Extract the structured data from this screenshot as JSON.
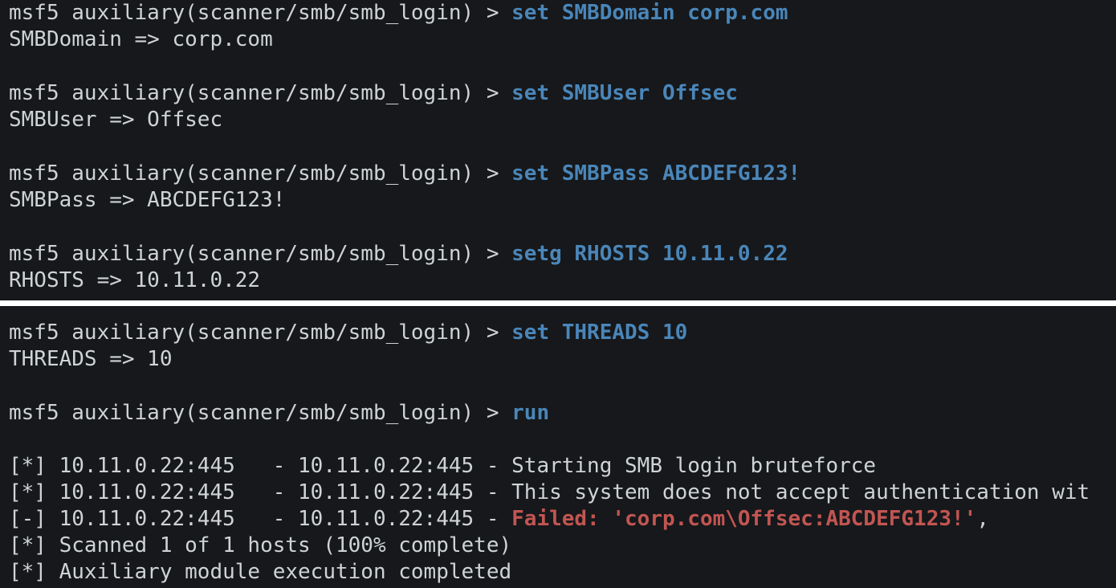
{
  "top": {
    "block1": {
      "prompt": "msf5 auxiliary(scanner/smb/smb_login) > ",
      "command": "set SMBDomain corp.com",
      "output": "SMBDomain => corp.com"
    },
    "block2": {
      "prompt": "msf5 auxiliary(scanner/smb/smb_login) > ",
      "command": "set SMBUser Offsec",
      "output": "SMBUser => Offsec"
    },
    "block3": {
      "prompt": "msf5 auxiliary(scanner/smb/smb_login) > ",
      "command": "set SMBPass ABCDEFG123!",
      "output": "SMBPass => ABCDEFG123!"
    },
    "block4": {
      "prompt": "msf5 auxiliary(scanner/smb/smb_login) > ",
      "command": "setg RHOSTS 10.11.0.22",
      "output": "RHOSTS => 10.11.0.22"
    }
  },
  "bottom": {
    "block1": {
      "prompt": "msf5 auxiliary(scanner/smb/smb_login) > ",
      "command": "set THREADS 10",
      "output": "THREADS => 10"
    },
    "block2": {
      "prompt": "msf5 auxiliary(scanner/smb/smb_login) > ",
      "command": "run"
    },
    "results": {
      "line1": "[*] 10.11.0.22:445   - 10.11.0.22:445 - Starting SMB login bruteforce",
      "line2": "[*] 10.11.0.22:445   - 10.11.0.22:445 - This system does not accept authentication wit",
      "line3_prefix": "[-] 10.11.0.22:445   - 10.11.0.22:445 - ",
      "line3_failed": "Failed: 'corp.com\\Offsec:ABCDEFG123!'",
      "line3_suffix": ",",
      "line4": "[*] Scanned 1 of 1 hosts (100% complete)",
      "line5": "[*] Auxiliary module execution completed"
    }
  },
  "colors": {
    "background": "#16181b",
    "text": "#cfd3d6",
    "command": "#4a86b9",
    "failed": "#c25552",
    "divider": "#ffffff"
  }
}
